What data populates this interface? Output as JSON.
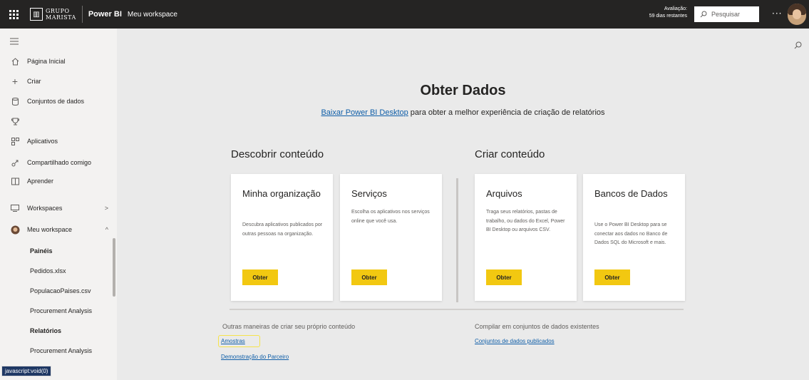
{
  "topbar": {
    "logo_line1": "GRUPO",
    "logo_line2": "MARISTA",
    "product": "Power BI",
    "breadcrumb": "Meu workspace",
    "trial_line1": "Avaliação:",
    "trial_line2": "59 dias restantes",
    "search_placeholder": "Pesquisar",
    "more": "···"
  },
  "sidebar": {
    "items": [
      {
        "label": "Página Inicial",
        "icon": "home-icon"
      },
      {
        "label": "Criar",
        "icon": "plus-icon"
      },
      {
        "label": "Conjuntos de dados",
        "icon": "database-icon"
      },
      {
        "label": "",
        "icon": "trophy-icon"
      },
      {
        "label": "Aplicativos",
        "icon": "apps-icon"
      },
      {
        "label": "Compartilhado comigo",
        "icon": "shared-icon"
      },
      {
        "label": "Aprender",
        "icon": "book-icon"
      },
      {
        "label": "Workspaces",
        "icon": "workspaces-icon"
      },
      {
        "label": "Meu workspace",
        "icon": "avatar-icon"
      }
    ],
    "sub_items": [
      {
        "label": "Painéis",
        "bold": true
      },
      {
        "label": "Pedidos.xlsx",
        "bold": false
      },
      {
        "label": "PopulacaoPaises.csv",
        "bold": false
      },
      {
        "label": "Procurement Analysis",
        "bold": false
      },
      {
        "label": "Relatórios",
        "bold": true
      },
      {
        "label": "Procurement Analysis",
        "bold": false
      }
    ],
    "status_url": "javascript:void(0)"
  },
  "main": {
    "title": "Obter Dados",
    "download_link": "Baixar Power BI Desktop",
    "subtitle_rest": " para obter a melhor experiência de criação de relatórios",
    "discover_heading": "Descobrir conteúdo",
    "create_heading": "Criar conteúdo",
    "cards": [
      {
        "title": "Minha organização",
        "desc": "Descubra aplicativos publicados por outras pessoas na organização.",
        "button": "Obter"
      },
      {
        "title": "Serviços",
        "desc": "Escolha os aplicativos nos serviços online que você usa.",
        "button": "Obter"
      },
      {
        "title": "Arquivos",
        "desc": "Traga seus relatórios, pastas de trabalho, ou dados do Excel, Power BI Desktop ou arquivos CSV.",
        "button": "Obter"
      },
      {
        "title": "Bancos de Dados",
        "desc": "Use o Power BI Desktop para se conectar aos dados no Banco de Dados SQL do Microsoft e mais.",
        "button": "Obter"
      }
    ],
    "other_heading": "Outras maneiras de criar seu próprio conteúdo",
    "samples_link": "Amostras",
    "partner_link": "Demonstração do Parceiro",
    "compile_heading": "Compilar em conjuntos de dados existentes",
    "published_link": "Conjuntos de dados publicados"
  },
  "colors": {
    "topbar": "#252423",
    "accent_yellow": "#f2c811",
    "link_blue": "#0f5ea8",
    "highlight": "#f5e34a"
  }
}
